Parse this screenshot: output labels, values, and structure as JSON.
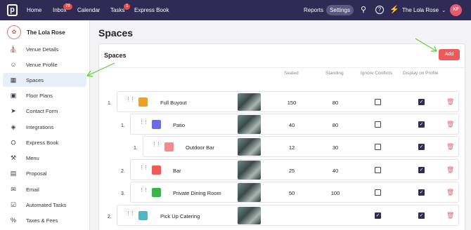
{
  "topnav": {
    "logo": "p",
    "home": "Home",
    "inbox": "Inbox",
    "inbox_badge": "79",
    "calendar": "Calendar",
    "tasks": "Tasks",
    "tasks_badge": "1",
    "express_book": "Express Book",
    "reports": "Reports",
    "settings": "Settings",
    "venue": "The Lola Rose",
    "avatar": "KF"
  },
  "sidebar": {
    "venue_name": "The Lola Rose",
    "items": [
      {
        "label": "Venue Details",
        "icon": "store-icon"
      },
      {
        "label": "Venue Profile",
        "icon": "user-icon"
      },
      {
        "label": "Spaces",
        "icon": "grid-icon"
      },
      {
        "label": "Floor Plans",
        "icon": "map-icon"
      },
      {
        "label": "Contact Form",
        "icon": "cursor-icon"
      },
      {
        "label": "Integrations",
        "icon": "cube-icon"
      },
      {
        "label": "Express Book",
        "icon": "cart-icon"
      },
      {
        "label": "Menu",
        "icon": "utensils-icon"
      },
      {
        "label": "Proposal",
        "icon": "file-icon"
      },
      {
        "label": "Email",
        "icon": "mail-icon"
      },
      {
        "label": "Automated Tasks",
        "icon": "checkbox-icon"
      },
      {
        "label": "Taxes & Fees",
        "icon": "percent-icon"
      }
    ]
  },
  "main": {
    "page_title": "Spaces",
    "card_title": "Spaces",
    "add_label": "Add",
    "columns": {
      "seated": "Seated",
      "standing": "Standing",
      "ignore": "Ignore Conflicts",
      "display": "Display on Profile"
    },
    "rows": [
      {
        "num": "1.",
        "name": "Full Buyout",
        "color": "#f59e1b",
        "seated": "150",
        "standing": "80",
        "ignore": false,
        "display": true
      },
      {
        "num": "1.",
        "name": "Patio",
        "color": "#6c6ce8",
        "seated": "40",
        "standing": "80",
        "ignore": false,
        "display": true
      },
      {
        "num": "1.",
        "name": "Outdoor Bar",
        "color": "#f28a8f",
        "seated": "12",
        "standing": "30",
        "ignore": false,
        "display": true
      },
      {
        "num": "2.",
        "name": "Bar",
        "color": "#ee5a5a",
        "seated": "25",
        "standing": "40",
        "ignore": false,
        "display": true
      },
      {
        "num": "3.",
        "name": "Private Dining Room",
        "color": "#3bb24a",
        "seated": "50",
        "standing": "100",
        "ignore": false,
        "display": true
      },
      {
        "num": "2.",
        "name": "Pick Up Catering",
        "color": "#4bb7c8",
        "seated": "",
        "standing": "",
        "ignore": true,
        "display": true
      }
    ]
  },
  "colors": {
    "nav_bg": "#2e2b55",
    "accent": "#ee5a5a",
    "active_bg": "#e9eff9",
    "annotation_arrow": "#5bd12e"
  }
}
